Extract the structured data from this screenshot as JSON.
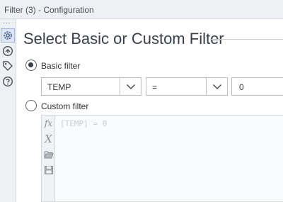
{
  "window": {
    "title": "Filter (3) - Configuration"
  },
  "sidebar": {
    "more_dots": "...",
    "items": [
      {
        "icon": "gear-icon",
        "active": true
      },
      {
        "icon": "connection-arrow-icon",
        "active": false
      },
      {
        "icon": "tag-icon",
        "active": false
      },
      {
        "icon": "help-icon",
        "active": false
      }
    ]
  },
  "main": {
    "heading": "Select Basic or Custom Filter",
    "basic": {
      "label": "Basic filter",
      "selected": true,
      "field": "TEMP",
      "operator": "=",
      "value": "0"
    },
    "custom": {
      "label": "Custom filter",
      "selected": false,
      "expression_placeholder": "[TEMP] = 0",
      "tools": [
        "fx",
        "X",
        "folder-open-icon",
        "save-icon"
      ]
    }
  }
}
